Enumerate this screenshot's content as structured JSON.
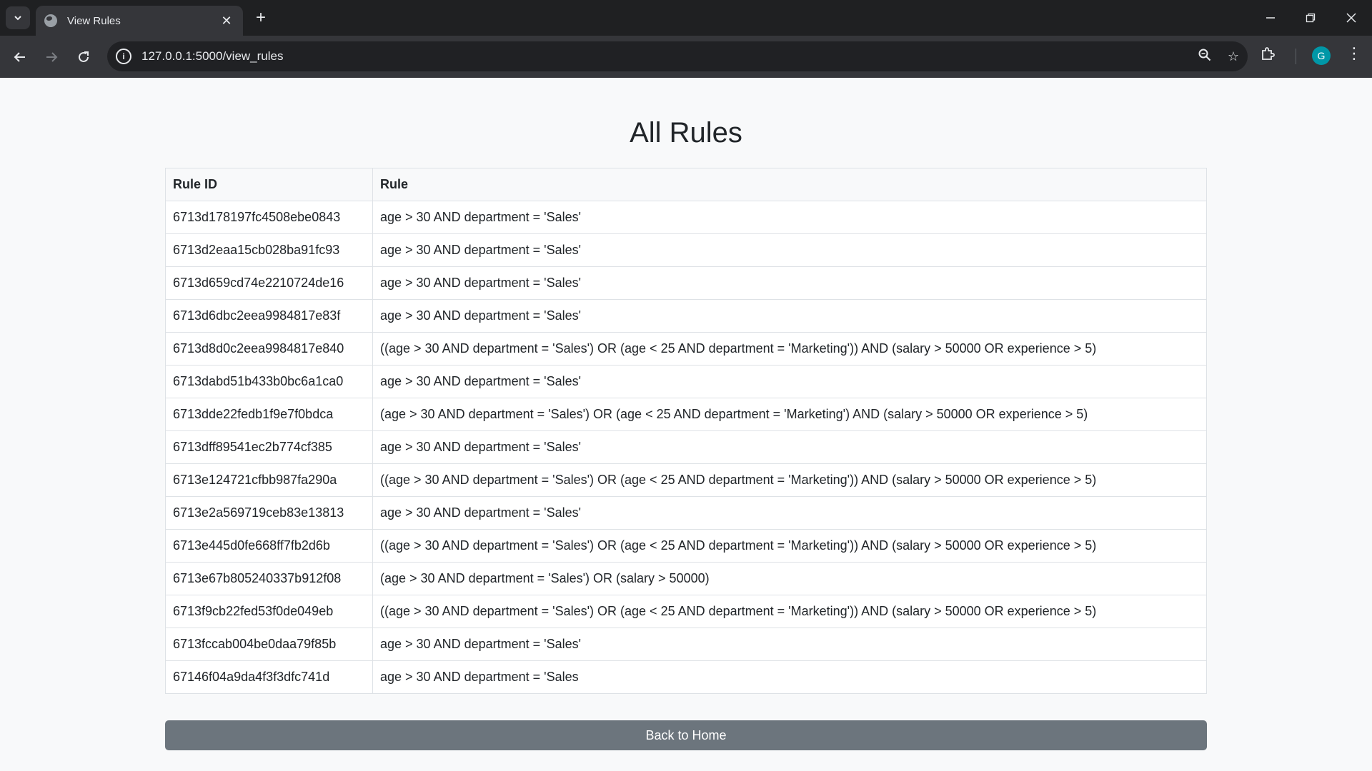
{
  "browser": {
    "tab_title": "View Rules",
    "url": "127.0.0.1:5000/view_rules",
    "avatar_letter": "G"
  },
  "page": {
    "title": "All Rules",
    "columns": [
      "Rule ID",
      "Rule"
    ],
    "rows": [
      {
        "id": "6713d178197fc4508ebe0843",
        "rule": "age > 30 AND department = 'Sales'"
      },
      {
        "id": "6713d2eaa15cb028ba91fc93",
        "rule": "age > 30 AND department = 'Sales'"
      },
      {
        "id": "6713d659cd74e2210724de16",
        "rule": "age > 30 AND department = 'Sales'"
      },
      {
        "id": "6713d6dbc2eea9984817e83f",
        "rule": "age > 30 AND department = 'Sales'"
      },
      {
        "id": "6713d8d0c2eea9984817e840",
        "rule": "((age > 30 AND department = 'Sales') OR (age < 25 AND department = 'Marketing')) AND (salary > 50000 OR experience > 5)"
      },
      {
        "id": "6713dabd51b433b0bc6a1ca0",
        "rule": "age > 30 AND department = 'Sales'"
      },
      {
        "id": "6713dde22fedb1f9e7f0bdca",
        "rule": "(age > 30 AND department = 'Sales') OR (age < 25 AND department = 'Marketing') AND (salary > 50000 OR experience > 5)"
      },
      {
        "id": "6713dff89541ec2b774cf385",
        "rule": "age > 30 AND department = 'Sales'"
      },
      {
        "id": "6713e124721cfbb987fa290a",
        "rule": "((age > 30 AND department = 'Sales') OR (age < 25 AND department = 'Marketing')) AND (salary > 50000 OR experience > 5)"
      },
      {
        "id": "6713e2a569719ceb83e13813",
        "rule": "age > 30 AND department = 'Sales'"
      },
      {
        "id": "6713e445d0fe668ff7fb2d6b",
        "rule": "((age > 30 AND department = 'Sales') OR (age < 25 AND department = 'Marketing')) AND (salary > 50000 OR experience > 5)"
      },
      {
        "id": "6713e67b805240337b912f08",
        "rule": "(age > 30 AND department = 'Sales') OR (salary > 50000)"
      },
      {
        "id": "6713f9cb22fed53f0de049eb",
        "rule": "((age > 30 AND department = 'Sales') OR (age < 25 AND department = 'Marketing')) AND (salary > 50000 OR experience > 5)"
      },
      {
        "id": "6713fccab004be0daa79f85b",
        "rule": "age > 30 AND department = 'Sales'"
      },
      {
        "id": "67146f04a9da4f3f3dfc741d",
        "rule": "age > 30 AND department = 'Sales"
      }
    ],
    "back_button": "Back to Home"
  }
}
